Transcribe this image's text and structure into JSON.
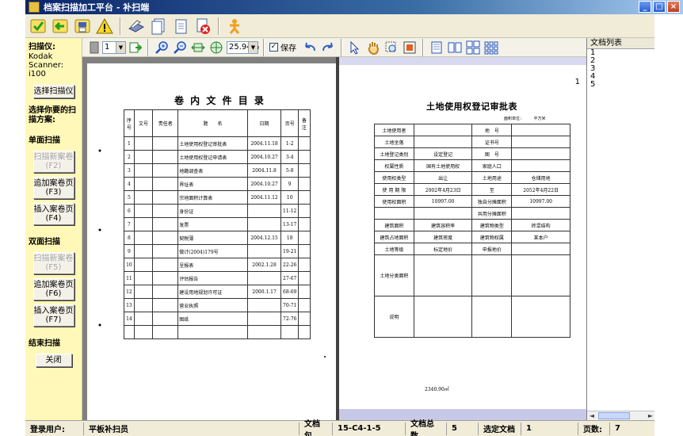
{
  "window": {
    "title": "档案扫描加工平台 - 补扫端",
    "controls": [
      "_",
      "□",
      "×"
    ]
  },
  "toolbar1": {
    "icons": [
      "check-icon",
      "back-icon",
      "save-icon",
      "warning-icon",
      "scanner-icon",
      "copy-page-icon",
      "page-icon",
      "delete-page-icon",
      "user-icon"
    ]
  },
  "left_panel": {
    "scanner_label": "扫描仪:",
    "scanner_name": "Kodak Scanner: i100",
    "select_scanner_btn": "选择扫描仪",
    "choose_plan_label": "选择你要的扫描方案:",
    "single_side_label": "单面扫描",
    "single_new_btn": "扫描新案卷(F2)",
    "single_append_btn": "追加案卷页(F3)",
    "single_insert_btn": "插入案卷页(F4)",
    "double_side_label": "双面扫描",
    "double_new_btn": "扫描新案卷(F5)",
    "double_append_btn": "追加案卷页(F6)",
    "double_insert_btn": "插入案卷页(F7)",
    "end_scan_label": "结束扫描",
    "close_btn": "关闭"
  },
  "toolbar2": {
    "page_number": "1",
    "zoom": "25.94%",
    "save_label": "保存",
    "save_checked": true
  },
  "document_list": {
    "header": "文档列表",
    "items": [
      "1",
      "2",
      "3",
      "4",
      "5"
    ],
    "selected_index": 0
  },
  "page_left": {
    "title": "卷 内 文 件 目 录",
    "headers": [
      "序号",
      "文号",
      "责任者",
      "题　　名",
      "日期",
      "页号",
      "备注"
    ],
    "rows": [
      [
        "1",
        "",
        "",
        "土地使用权登记审批表",
        "2004.11.18",
        "1-2",
        ""
      ],
      [
        "2",
        "",
        "",
        "土地使用权登记申请表",
        "2004.10.27",
        "3-4",
        ""
      ],
      [
        "3",
        "",
        "",
        "地籍调查表",
        "2004.11.8",
        "5-8",
        ""
      ],
      [
        "4",
        "",
        "",
        "界址表",
        "2004.10.27",
        "9",
        ""
      ],
      [
        "5",
        "",
        "",
        "宗地面积计算表",
        "2004.11.12",
        "10",
        ""
      ],
      [
        "6",
        "",
        "",
        "身份证",
        "",
        "11-12",
        ""
      ],
      [
        "7",
        "",
        "",
        "发票",
        "",
        "13-17",
        ""
      ],
      [
        "8",
        "",
        "",
        "契税薄",
        "2004.12.15",
        "18",
        ""
      ],
      [
        "9",
        "",
        "",
        "做计(2004)179号",
        "",
        "19-21",
        ""
      ],
      [
        "10",
        "",
        "",
        "呈报表",
        "2002.1.28",
        "22-26",
        ""
      ],
      [
        "11",
        "",
        "",
        "评估报告",
        "",
        "27-67",
        ""
      ],
      [
        "12",
        "",
        "",
        "建设用地规划许可证",
        "2000.1.17",
        "68-69",
        ""
      ],
      [
        "13",
        "",
        "",
        "营业执照",
        "",
        "70-71",
        ""
      ],
      [
        "14",
        "",
        "",
        "图纸",
        "",
        "72-76",
        ""
      ],
      [
        "",
        "",
        "",
        "",
        "",
        "",
        ""
      ]
    ]
  },
  "page_right": {
    "corner_number": "1",
    "title": "土地使用权登记审批表",
    "area_unit": "面积单位：　　　平方米",
    "rows": [
      [
        "土地使用者",
        "",
        "地　号",
        ""
      ],
      [
        "土地坐落",
        "",
        "证书号",
        ""
      ],
      [
        "土地登记类别",
        "设定登记",
        "图　号",
        ""
      ],
      [
        "权属性质",
        "国有土地使用权",
        "家庭人口",
        ""
      ],
      [
        "使用权类型",
        "出让",
        "土地用途",
        "仓储用地"
      ],
      [
        "使 用 期 限",
        "2002年4月23日",
        "至",
        "2052年4月22日"
      ],
      [
        "使用权面积",
        "10997.00",
        "独自分摊面积",
        "10997.00"
      ],
      [
        "",
        "",
        "共用分摊面积",
        ""
      ],
      [
        "建筑面积",
        "建筑容积率",
        "建筑物类型",
        "砖混结构"
      ],
      [
        "建筑占地面积",
        "建筑密度",
        "建筑物权属",
        "某本户"
      ],
      [
        "土地等级",
        "标定地价",
        "申报地价",
        ""
      ],
      [
        "土地分类面积",
        "",
        "",
        ""
      ],
      [
        "说明",
        "",
        "",
        ""
      ]
    ],
    "bottom_note": "2340.90㎡"
  },
  "status_bar": {
    "user_label": "登录用户:",
    "user_value": "平板补扫员",
    "package_label": "文档包",
    "package_value": "15-C4-1-5",
    "total_label": "文档总数",
    "total_value": "5",
    "selected_label": "选定文档",
    "selected_value": "1",
    "pages_label": "页数:",
    "pages_value": "7"
  },
  "colors": {
    "title_bar": "#0a246a",
    "left_panel_bg": "#fff8b8",
    "toolbar_bg": "#f0ecd8",
    "viewer_bg": "#808080"
  }
}
